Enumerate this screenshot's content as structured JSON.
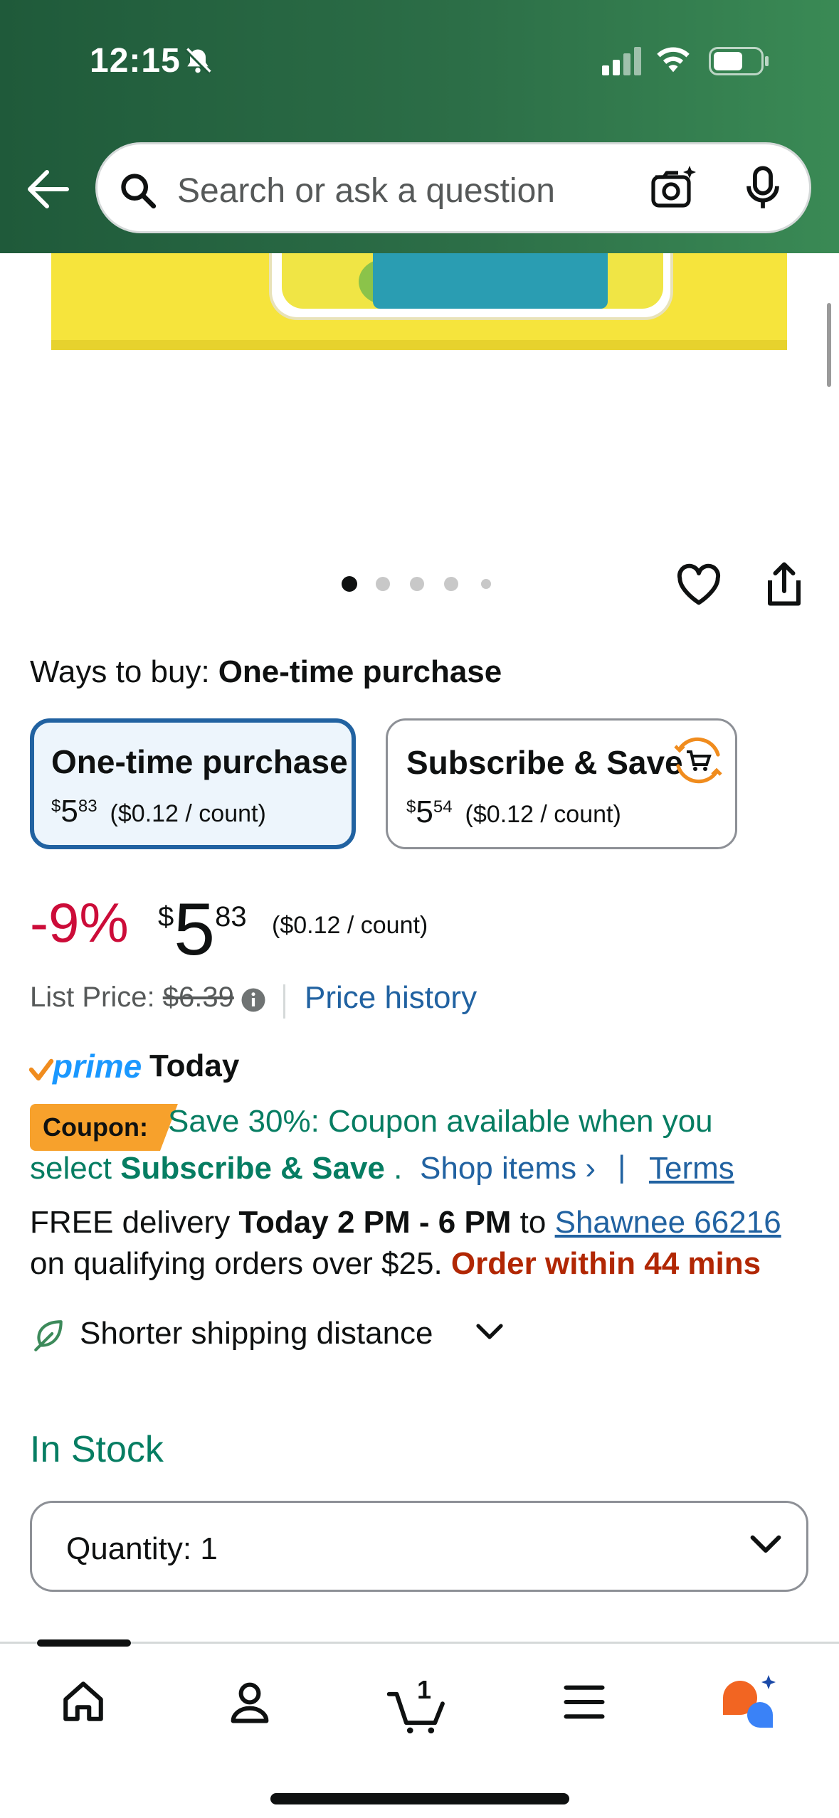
{
  "status_bar": {
    "time": "12:15"
  },
  "search": {
    "placeholder": "Search or ask a question"
  },
  "gallery": {
    "dot_count": 5,
    "active_index": 0
  },
  "buying": {
    "ways_label": "Ways to buy:",
    "ways_selected": "One-time purchase",
    "options": [
      {
        "title": "One-time purchase",
        "currency": "$",
        "whole": "5",
        "cents": "83",
        "unit": "($0.12 / count)",
        "selected": true
      },
      {
        "title": "Subscribe & Save",
        "currency": "$",
        "whole": "5",
        "cents": "54",
        "unit": "($0.12 / count)",
        "selected": false
      }
    ]
  },
  "price": {
    "discount": "-9%",
    "currency": "$",
    "whole": "5",
    "cents": "83",
    "unit": "($0.12 / count)",
    "list_label": "List Price:",
    "list_value": "$6.39",
    "history_link": "Price history"
  },
  "prime": {
    "word": "prime",
    "today": "Today"
  },
  "coupon": {
    "badge": "Coupon:",
    "line1": "Save 30%: Coupon available when you",
    "line2_prefix": "select ",
    "line2_bold": "Subscribe & Save",
    "line2_suffix": " .",
    "shop_items": "Shop items ›",
    "separator": "|",
    "terms": "Terms"
  },
  "delivery": {
    "prefix": "FREE delivery ",
    "window": "Today 2 PM - 6 PM",
    "to": " to ",
    "location": "Shawnee 66216",
    "line2_prefix": "on qualifying orders over $25. ",
    "urgent": "Order within 44 mins"
  },
  "sustainability": {
    "label": "Shorter shipping distance"
  },
  "stock": {
    "status": "In Stock"
  },
  "quantity": {
    "label": "Quantity:",
    "value": "1"
  },
  "cart": {
    "count": "1"
  },
  "colors": {
    "header_green": "#2c6e47",
    "link_blue": "#2162a1",
    "deal_red": "#cc0c39",
    "stock_green": "#067d62",
    "coupon_orange": "#f7a12c",
    "urgent_red": "#b12704"
  }
}
